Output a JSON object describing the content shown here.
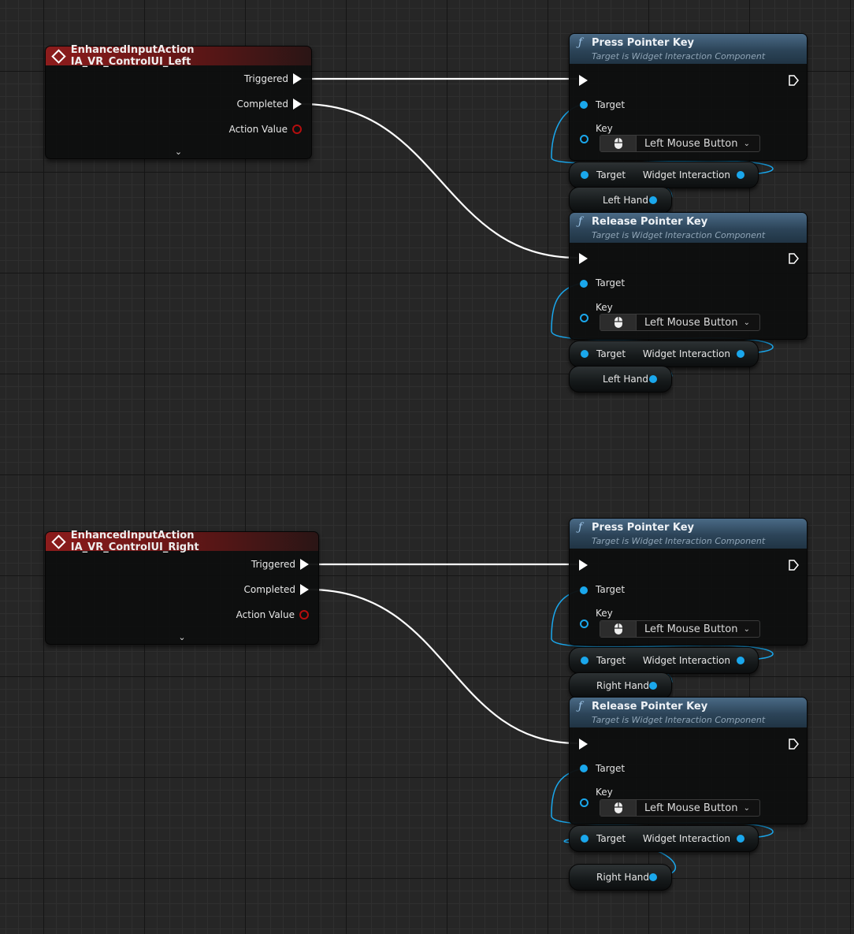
{
  "groups": [
    {
      "event": {
        "title": "EnhancedInputAction IA_VR_ControlUI_Left",
        "pins": [
          "Triggered",
          "Completed",
          "Action Value"
        ],
        "expand_icon": "chevron-down-icon"
      },
      "press": {
        "glyph": "ƒ",
        "title": "Press Pointer Key",
        "subtitle": "Target is Widget Interaction Component",
        "target_label": "Target",
        "key_label": "Key",
        "key_value": "Left Mouse Button"
      },
      "press_getter": {
        "target": "Target",
        "output": "Widget Interaction"
      },
      "press_var": "Left Hand",
      "release": {
        "glyph": "ƒ",
        "title": "Release Pointer Key",
        "subtitle": "Target is Widget Interaction Component",
        "target_label": "Target",
        "key_label": "Key",
        "key_value": "Left Mouse Button"
      },
      "release_getter": {
        "target": "Target",
        "output": "Widget Interaction"
      },
      "release_var": "Left Hand"
    },
    {
      "event": {
        "title": "EnhancedInputAction IA_VR_ControlUI_Right",
        "pins": [
          "Triggered",
          "Completed",
          "Action Value"
        ],
        "expand_icon": "chevron-down-icon"
      },
      "press": {
        "glyph": "ƒ",
        "title": "Press Pointer Key",
        "subtitle": "Target is Widget Interaction Component",
        "target_label": "Target",
        "key_label": "Key",
        "key_value": "Left Mouse Button"
      },
      "press_getter": {
        "target": "Target",
        "output": "Widget Interaction"
      },
      "press_var": "Right Hand",
      "release": {
        "glyph": "ƒ",
        "title": "Release Pointer Key",
        "subtitle": "Target is Widget Interaction Component",
        "target_label": "Target",
        "key_label": "Key",
        "key_value": "Left Mouse Button"
      },
      "release_getter": {
        "target": "Target",
        "output": "Widget Interaction"
      },
      "release_var": "Right Hand"
    }
  ],
  "colors": {
    "event_header": "#8c1c1c",
    "function_header": "#2c4458",
    "object_pin": "#1aa7ec",
    "struct_pin": "#b40e0e",
    "exec_wire": "#ffffff"
  }
}
